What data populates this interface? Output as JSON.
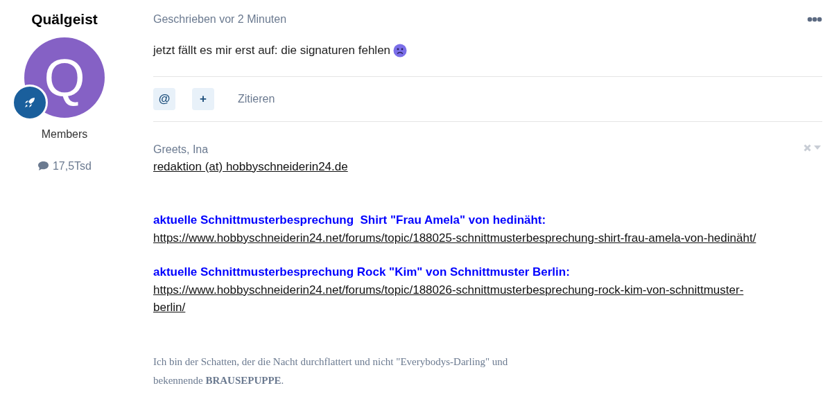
{
  "author": {
    "name": "Quälgeist",
    "avatar_letter": "Q",
    "group": "Members",
    "post_count": "17,5Tsd"
  },
  "post": {
    "meta": "Geschrieben vor 2 Minuten",
    "text": "jetzt fällt es mir erst auf: die signaturen fehlen"
  },
  "actions": [
    {
      "kind": "icon",
      "label": "@"
    },
    {
      "kind": "icon",
      "label": "+"
    },
    {
      "kind": "text",
      "label": "Zitieren"
    }
  ],
  "signature": [
    {
      "kind": "plain",
      "text": "Greets, Ina"
    },
    {
      "kind": "link",
      "text": "redaktion (at) hobbyschneiderin24.de"
    },
    {
      "kind": "gap"
    },
    {
      "kind": "heading",
      "text": "aktuelle Schnittmusterbesprechung  Shirt \"Frau Amela\" von hedinäht:"
    },
    {
      "kind": "link",
      "text": "https://www.hobbyschneiderin24.net/forums/topic/188025-schnittmusterbesprechung-shirt-frau-amela-von-hedinäht/"
    },
    {
      "kind": "small-gap"
    },
    {
      "kind": "heading",
      "text": "aktuelle Schnittmusterbesprechung Rock \"Kim\" von Schnittmuster Berlin:"
    },
    {
      "kind": "link",
      "text": "https://www.hobbyschneiderin24.net/forums/topic/188026-schnittmusterbesprechung-rock-kim-von-schnittmuster-berlin/"
    },
    {
      "kind": "gap"
    },
    {
      "kind": "quote",
      "text": "Ich bin der Schatten, der die Nacht durchflattert und nicht \"Everybodys-Darling\" und bekennende **BRAUSEPUPPE**."
    }
  ]
}
